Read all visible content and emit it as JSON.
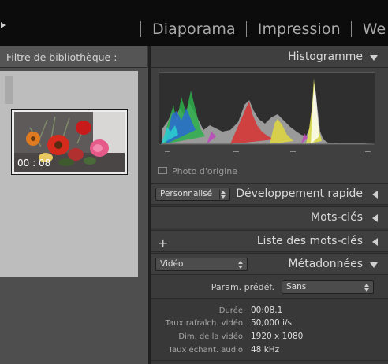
{
  "module_bar": {
    "modules": [
      "Diaporama",
      "Impression",
      "We"
    ]
  },
  "library_filter": {
    "label": "Filtre de bibliothèque :"
  },
  "grid": {
    "thumbnail": {
      "duration": "00 : 08"
    }
  },
  "panels": {
    "histogram": {
      "title": "Histogramme",
      "original_photo_label": "Photo d'origine"
    },
    "quick_develop": {
      "title": "Développement rapide",
      "preset_value": "Personnalisé"
    },
    "keywording": {
      "title": "Mots-clés"
    },
    "keyword_list": {
      "title": "Liste des mots-clés"
    },
    "metadata": {
      "title": "Métadonnées",
      "view_value": "Vidéo",
      "preset_label": "Param. prédéf.",
      "preset_value": "Sans",
      "rows": [
        {
          "label": "Durée",
          "value": "00:08.1"
        },
        {
          "label": "Taux rafraîch. vidéo",
          "value": "50,000 i/s"
        },
        {
          "label": "Dim. de la vidéo",
          "value": "1920 x 1080"
        },
        {
          "label": "Taux échant. audio",
          "value": "48 kHz"
        }
      ]
    }
  },
  "colors": {
    "background": "#383838",
    "top_bar": "#0c0c0c",
    "panel_header": "#3f3f3f",
    "grid_cell": "#bdbdbd"
  }
}
